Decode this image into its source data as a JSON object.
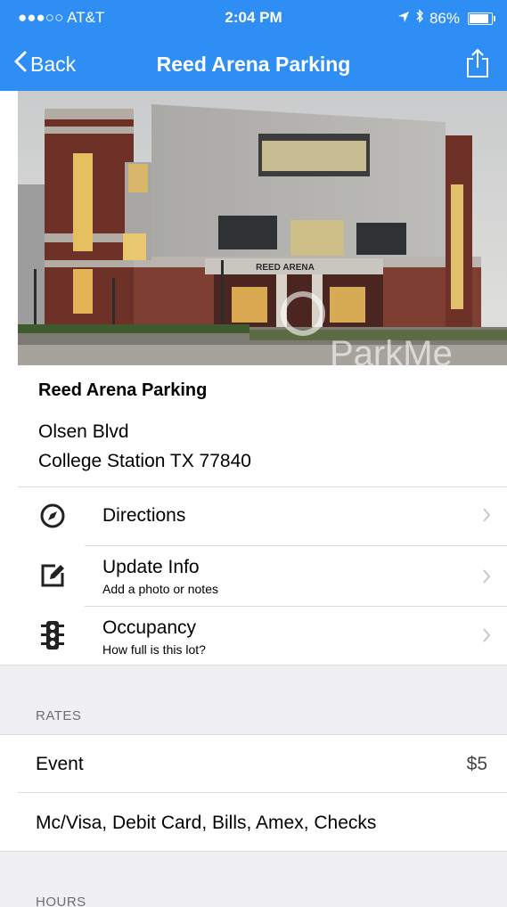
{
  "status_bar": {
    "carrier": "●●●○○ AT&T",
    "time": "2:04 PM",
    "battery": "86%",
    "battery_level": 0.86
  },
  "nav": {
    "back_label": "Back",
    "title": "Reed Arena Parking"
  },
  "photo": {
    "building_sign": "REED ARENA",
    "watermark": "ParkMe"
  },
  "lot": {
    "name": "Reed Arena Parking",
    "address_line1": "Olsen Blvd",
    "address_line2": "College Station TX 77840"
  },
  "actions": [
    {
      "label": "Directions",
      "icon": "compass-icon"
    },
    {
      "label": "Update Info",
      "sub": "Add a photo or notes",
      "icon": "edit-icon"
    },
    {
      "label": "Occupancy",
      "sub": "How full is this lot?",
      "icon": "traffic-light-icon"
    }
  ],
  "rates": {
    "section_title": "RATES",
    "event_label": "Event",
    "event_price": "$5",
    "payment_methods": "Mc/Visa, Debit Card, Bills, Amex, Checks"
  },
  "hours": {
    "section_title": "HOURS"
  },
  "colors": {
    "accent": "#2f8ef3",
    "separator": "#dcdcdc",
    "section_bg": "#efeff4"
  }
}
